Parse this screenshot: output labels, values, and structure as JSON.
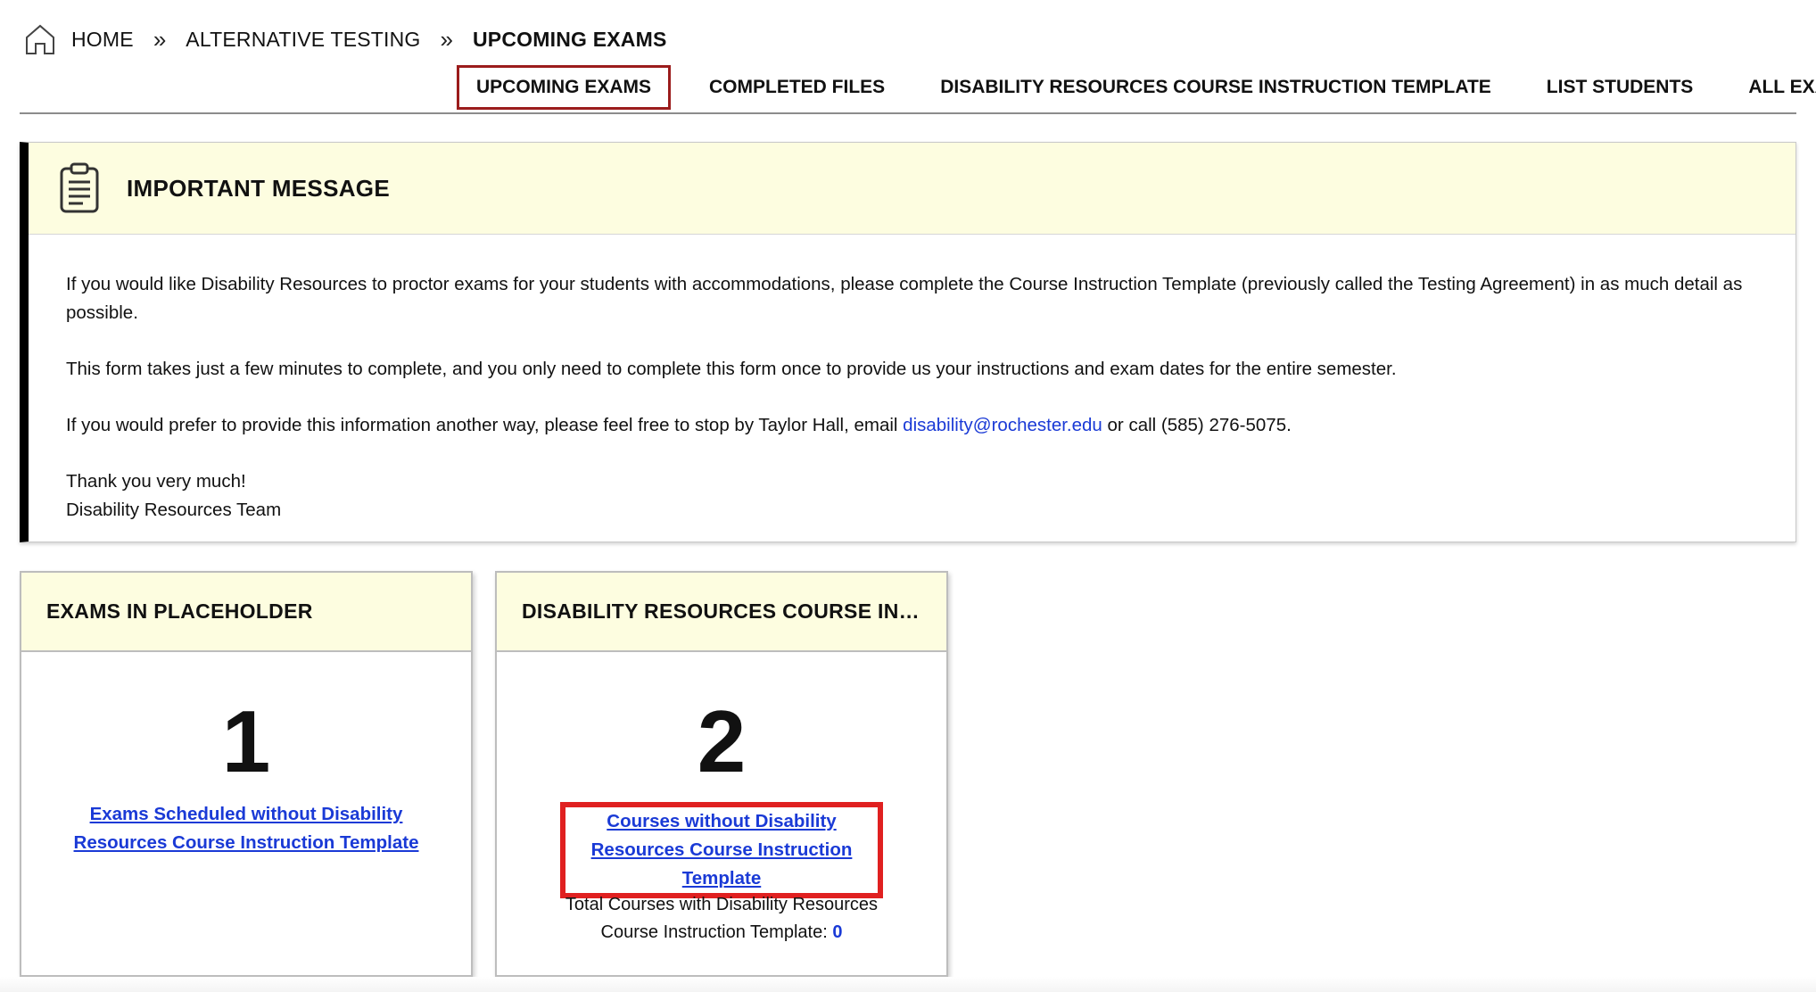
{
  "breadcrumb": {
    "home": "HOME",
    "section": "ALTERNATIVE TESTING",
    "current": "UPCOMING EXAMS"
  },
  "tabs": [
    {
      "label": "UPCOMING EXAMS",
      "active": true
    },
    {
      "label": "COMPLETED FILES"
    },
    {
      "label": "DISABILITY RESOURCES COURSE INSTRUCTION TEMPLATE"
    },
    {
      "label": "LIST STUDENTS"
    },
    {
      "label": "ALL EXAMS"
    }
  ],
  "message": {
    "title": "IMPORTANT MESSAGE",
    "icon": "clipboard-icon",
    "p1": "If you would like Disability Resources to proctor exams for your students with accommodations, please complete the Course Instruction Template (previously called the Testing Agreement) in as much detail as possible.",
    "p2": "This form takes just a few minutes to complete, and you only need to complete this form once to provide us your instructions and exam dates for the entire semester.",
    "p3_before": "If you would prefer to provide this information another way, please feel free to stop by Taylor Hall, email ",
    "p3_email": "disability@rochester.edu",
    "p3_after": " or call (585) 276-5075.",
    "thanks": "Thank you very much!",
    "signature": "Disability Resources Team"
  },
  "cards": [
    {
      "title": "EXAMS IN PLACEHOLDER",
      "number": "1",
      "link": "Exams Scheduled without Disability Resources Course Instruction Template"
    },
    {
      "title": "DISABILITY RESOURCES COURSE INSTRUCTION TEMPLATE",
      "number": "2",
      "link": "Courses without Disability Resources Course Instruction Template",
      "total_label": "Total Courses with Disability Resources Course Instruction Template: ",
      "total_value": "0"
    }
  ],
  "colors": {
    "accent_link": "#1a3ad6",
    "active_tab_border": "#9b1c1c",
    "highlight_box": "#e02020",
    "header_bg": "#fdfde0"
  }
}
